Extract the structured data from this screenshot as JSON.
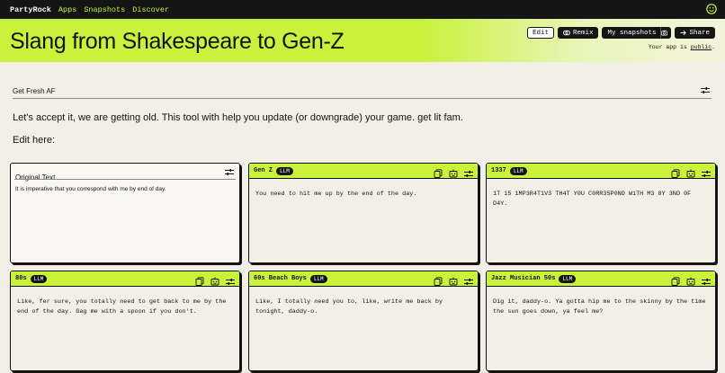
{
  "nav": {
    "brand": "PartyRock",
    "links": [
      "Apps",
      "Snapshots",
      "Discover"
    ]
  },
  "header": {
    "title": "Slang from Shakespeare to Gen-Z",
    "edit_label": "Edit",
    "remix_label": "Remix",
    "snapshots_label": "My snapshots",
    "share_label": "Share",
    "public_prefix": "Your app is ",
    "public_link": "public",
    "public_suffix": "."
  },
  "input": {
    "label": "Get Fresh AF"
  },
  "description": "Let's accept it, we are getting old. This tool with help you update (or downgrade) your game. get lit fam.",
  "edit_here": "Edit here:",
  "original": {
    "title": "Original Text",
    "text": "It is imperative that you correspond with me by end of day."
  },
  "cards": [
    {
      "title": "Gen Z",
      "badge": "LLM",
      "text": "You need to hit me up by the end of the day."
    },
    {
      "title": "1337",
      "badge": "LLM",
      "text": "1T 15 1MP3R4T1V3 TH4T Y0U C0RR35P0ND W1TH M3 8Y 3ND 0F D4Y."
    },
    {
      "title": "80s",
      "badge": "LLM",
      "text": "Like, fer sure, you totally need to get back to me by the end of the day. Gag me with a spoon if you don't."
    },
    {
      "title": "60s Beach Boys",
      "badge": "LLM",
      "text": "Like, I totally need you to, like, write me back by tonight, daddy-o."
    },
    {
      "title": "Jazz Musician 50s",
      "badge": "LLM",
      "text": "Dig it, daddy-o. Ya gotta hip me to the skinny by the time the sun goes down, ya feel me?"
    }
  ],
  "colors": {
    "accent": "#c8f23c",
    "dark": "#151515",
    "background": "#f1efe6"
  }
}
